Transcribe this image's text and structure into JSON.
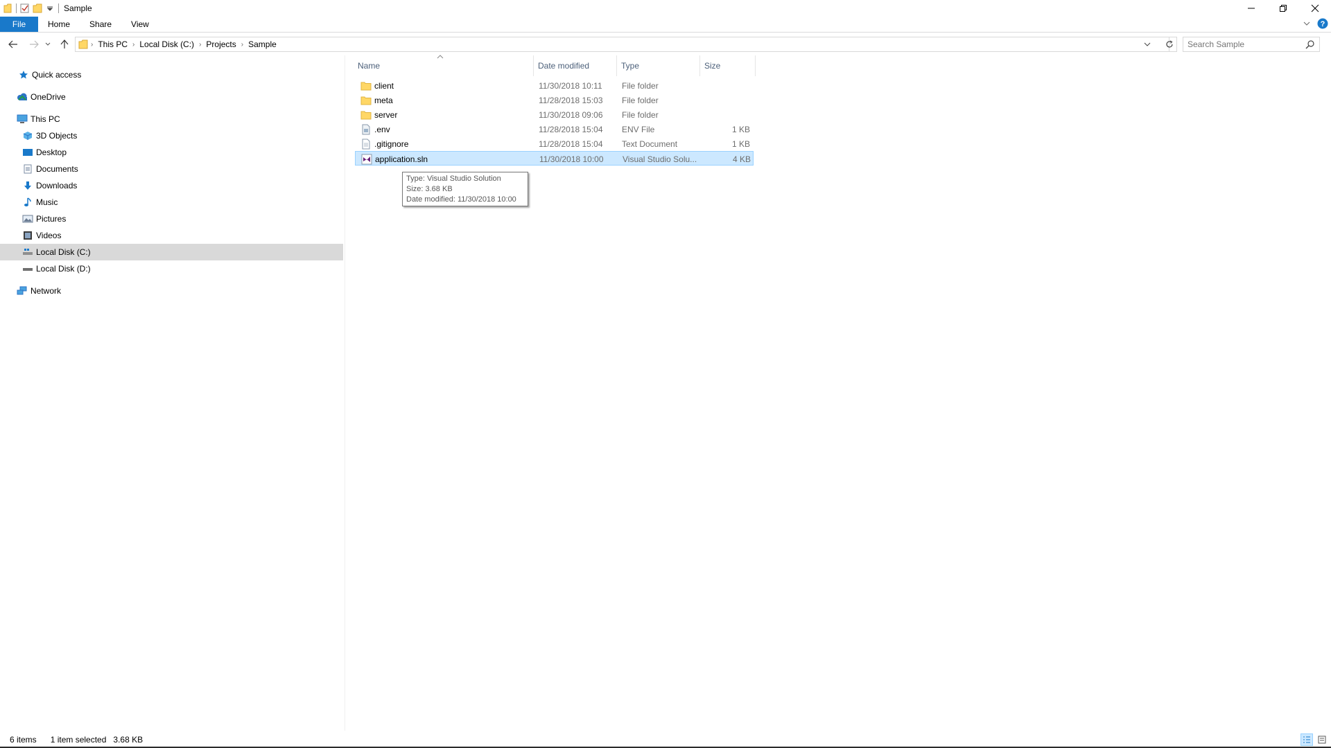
{
  "window": {
    "title": "Sample"
  },
  "ribbon": {
    "tabs": [
      "File",
      "Home",
      "Share",
      "View"
    ]
  },
  "address": {
    "crumbs": [
      "This PC",
      "Local Disk (C:)",
      "Projects",
      "Sample"
    ]
  },
  "search": {
    "placeholder": "Search Sample"
  },
  "navpane": {
    "items": [
      {
        "label": "Quick access",
        "icon": "star-icon"
      },
      {
        "label": "OneDrive",
        "icon": "cloud-icon"
      },
      {
        "label": "This PC",
        "icon": "computer-icon"
      },
      {
        "label": "3D Objects",
        "icon": "cube-icon"
      },
      {
        "label": "Desktop",
        "icon": "desktop-icon"
      },
      {
        "label": "Documents",
        "icon": "document-icon"
      },
      {
        "label": "Downloads",
        "icon": "download-icon"
      },
      {
        "label": "Music",
        "icon": "music-icon"
      },
      {
        "label": "Pictures",
        "icon": "picture-icon"
      },
      {
        "label": "Videos",
        "icon": "video-icon"
      },
      {
        "label": "Local Disk (C:)",
        "icon": "drive-icon"
      },
      {
        "label": "Local Disk (D:)",
        "icon": "drive-icon"
      },
      {
        "label": "Network",
        "icon": "network-icon"
      }
    ]
  },
  "list": {
    "columns": [
      "Name",
      "Date modified",
      "Type",
      "Size"
    ],
    "rows": [
      {
        "name": "client",
        "date": "11/30/2018 10:11",
        "type": "File folder",
        "size": "",
        "icon": "folder-icon"
      },
      {
        "name": "meta",
        "date": "11/28/2018 15:03",
        "type": "File folder",
        "size": "",
        "icon": "folder-icon"
      },
      {
        "name": "server",
        "date": "11/30/2018 09:06",
        "type": "File folder",
        "size": "",
        "icon": "folder-icon"
      },
      {
        "name": ".env",
        "date": "11/28/2018 15:04",
        "type": "ENV File",
        "size": "1 KB",
        "icon": "env-file-icon"
      },
      {
        "name": ".gitignore",
        "date": "11/28/2018 15:04",
        "type": "Text Document",
        "size": "1 KB",
        "icon": "text-file-icon"
      },
      {
        "name": "application.sln",
        "date": "11/30/2018 10:00",
        "type": "Visual Studio Solu...",
        "size": "4 KB",
        "icon": "visual-studio-solution-icon"
      }
    ]
  },
  "tooltip": {
    "line1": "Type: Visual Studio Solution",
    "line2": "Size: 3.68 KB",
    "line3": "Date modified: 11/30/2018 10:00"
  },
  "status": {
    "items_count": "6 items",
    "selected": "1 item selected",
    "selected_size": "3.68 KB"
  },
  "colors": {
    "accent": "#1979ca",
    "selection": "#cce8ff",
    "selection_border": "#99d1ff",
    "folder": "#ffd766"
  }
}
